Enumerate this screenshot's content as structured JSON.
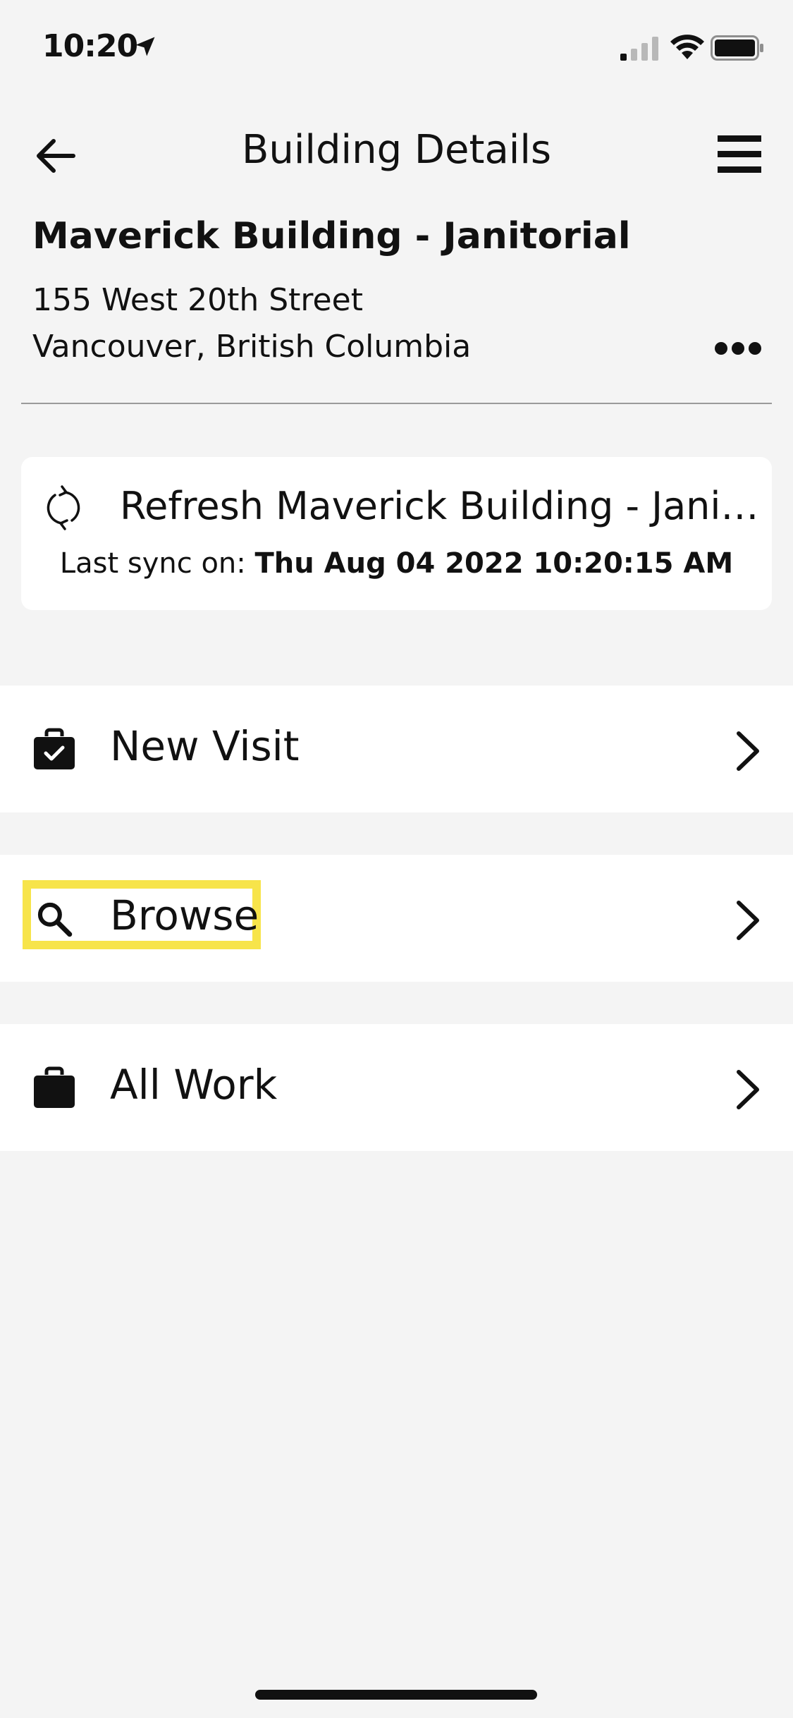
{
  "status_bar": {
    "time": "10:20",
    "icons": [
      "location-arrow-icon",
      "cellular-signal-icon",
      "wifi-icon",
      "battery-icon"
    ]
  },
  "nav": {
    "title": "Building Details",
    "back_icon": "arrow-left-icon",
    "menu_icon": "hamburger-menu-icon"
  },
  "building": {
    "name": "Maverick Building - Janitorial",
    "address_line1": "155 West 20th Street",
    "address_line2": "Vancouver, British Columbia",
    "more_icon": "ellipsis-icon"
  },
  "refresh_card": {
    "label": "Refresh Maverick Building - Janitorial",
    "sync_prefix": "Last sync on:",
    "sync_value": "Thu Aug 04 2022 10:20:15 AM",
    "icon": "refresh-icon"
  },
  "menu": {
    "items": [
      {
        "label": "New Visit",
        "icon": "briefcase-check-icon"
      },
      {
        "label": "Browse",
        "icon": "search-icon",
        "highlighted": true
      },
      {
        "label": "All Work",
        "icon": "briefcase-icon"
      }
    ]
  },
  "colors": {
    "background": "#f4f4f4",
    "card": "#ffffff",
    "highlight": "#f7e44a",
    "text": "#111111",
    "divider": "#9a9a9a"
  }
}
